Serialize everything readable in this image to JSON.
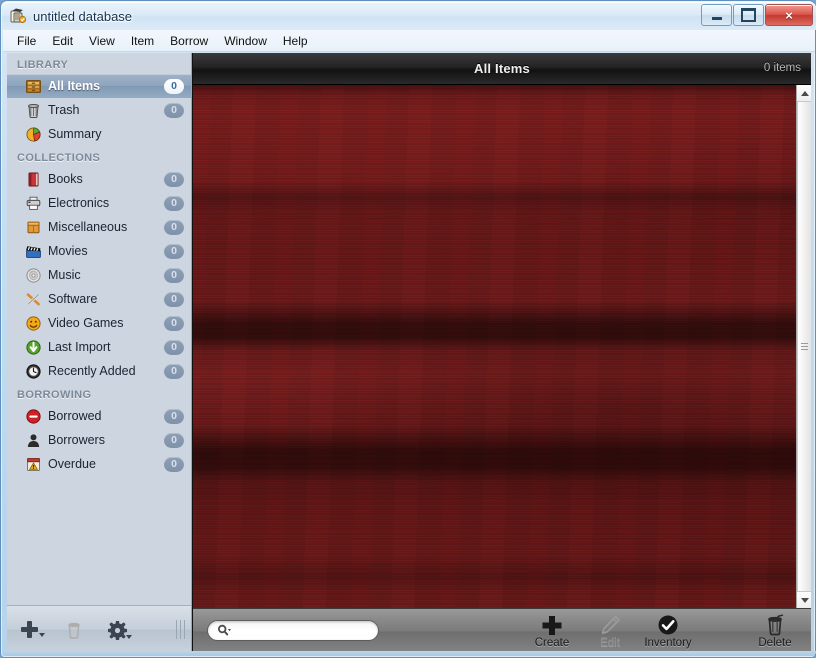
{
  "window": {
    "title": "untitled database",
    "app_icon": "books-media-icon",
    "controls": {
      "minimize": "minimize-button",
      "maximize": "maximize-button",
      "close": "×"
    }
  },
  "menubar": {
    "items": [
      {
        "label": "File"
      },
      {
        "label": "Edit"
      },
      {
        "label": "View"
      },
      {
        "label": "Item"
      },
      {
        "label": "Borrow"
      },
      {
        "label": "Window"
      },
      {
        "label": "Help"
      }
    ]
  },
  "sidebar": {
    "sections": [
      {
        "header": "LIBRARY",
        "items": [
          {
            "label": "All Items",
            "badge": "0",
            "icon": "archive-drawer-icon",
            "selected": true
          },
          {
            "label": "Trash",
            "badge": "0",
            "icon": "trash-can-icon",
            "selected": false
          },
          {
            "label": "Summary",
            "badge": "",
            "icon": "pie-chart-icon",
            "selected": false
          }
        ]
      },
      {
        "header": "COLLECTIONS",
        "items": [
          {
            "label": "Books",
            "badge": "0",
            "icon": "red-book-icon",
            "selected": false
          },
          {
            "label": "Electronics",
            "badge": "0",
            "icon": "printer-icon",
            "selected": false
          },
          {
            "label": "Miscellaneous",
            "badge": "0",
            "icon": "orange-box-icon",
            "selected": false
          },
          {
            "label": "Movies",
            "badge": "0",
            "icon": "clapperboard-icon",
            "selected": false
          },
          {
            "label": "Music",
            "badge": "0",
            "icon": "compact-disc-icon",
            "selected": false
          },
          {
            "label": "Software",
            "badge": "0",
            "icon": "crossed-tools-icon",
            "selected": false
          },
          {
            "label": "Video Games",
            "badge": "0",
            "icon": "smiley-face-icon",
            "selected": false
          },
          {
            "label": "Last Import",
            "badge": "0",
            "icon": "green-down-arrow-icon",
            "selected": false
          },
          {
            "label": "Recently Added",
            "badge": "0",
            "icon": "clock-icon",
            "selected": false
          }
        ]
      },
      {
        "header": "BORROWING",
        "items": [
          {
            "label": "Borrowed",
            "badge": "0",
            "icon": "no-entry-icon",
            "selected": false
          },
          {
            "label": "Borrowers",
            "badge": "0",
            "icon": "person-silhouette-icon",
            "selected": false
          },
          {
            "label": "Overdue",
            "badge": "0",
            "icon": "calendar-warning-icon",
            "selected": false
          }
        ]
      }
    ],
    "toolbar": {
      "add": "add-collection-button",
      "delete": "delete-collection-button",
      "settings": "collection-actions-button"
    }
  },
  "content": {
    "title": "All Items",
    "items_count": "0 items",
    "background": "mahogany-wood-texture",
    "search": {
      "value": "",
      "placeholder": "",
      "icon": "magnifier-icon"
    },
    "actions": [
      {
        "label": "Create",
        "icon": "plus-icon",
        "disabled": false
      },
      {
        "label": "Edit",
        "icon": "pencil-icon",
        "disabled": true
      },
      {
        "label": "Inventory",
        "icon": "check-circle-icon",
        "disabled": false
      },
      {
        "label": "Delete",
        "icon": "trash-can-icon",
        "disabled": false
      }
    ]
  },
  "colors": {
    "sidebar_bg": "#ccd5e0",
    "selection": "#8ea4bd",
    "wood": "#6b1c1c",
    "header_bar": "#1d1d1d",
    "footer_bar": "#808080",
    "title_text": "#16324f"
  }
}
